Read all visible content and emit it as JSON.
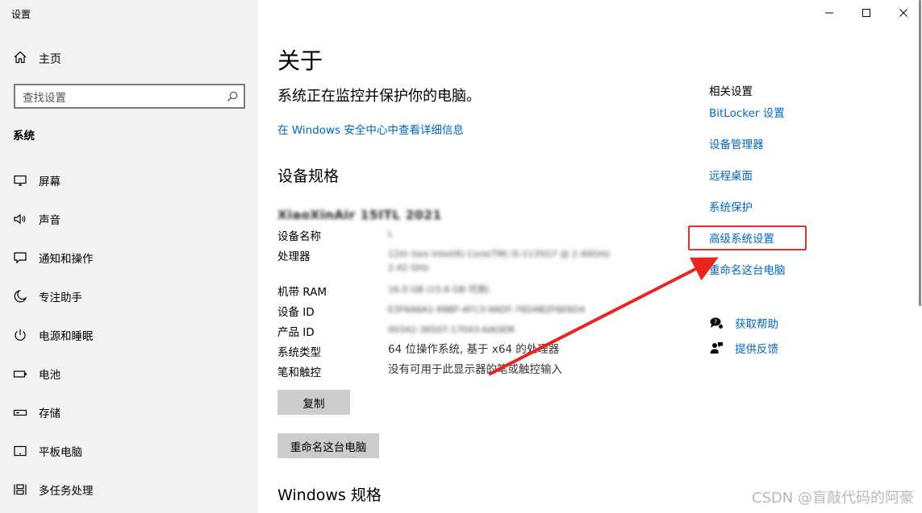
{
  "window": {
    "title": "设置",
    "controls": {
      "minimize": "minimize-icon",
      "maximize": "maximize-icon",
      "close": "close-icon"
    }
  },
  "sidebar": {
    "home_label": "主页",
    "search_placeholder": "查找设置",
    "section_label": "系统",
    "items": [
      {
        "label": "屏幕",
        "icon": "monitor-icon"
      },
      {
        "label": "声音",
        "icon": "speaker-icon"
      },
      {
        "label": "通知和操作",
        "icon": "notification-icon"
      },
      {
        "label": "专注助手",
        "icon": "moon-icon"
      },
      {
        "label": "电源和睡眠",
        "icon": "power-icon"
      },
      {
        "label": "电池",
        "icon": "battery-icon"
      },
      {
        "label": "存储",
        "icon": "storage-icon"
      },
      {
        "label": "平板电脑",
        "icon": "tablet-icon"
      },
      {
        "label": "多任务处理",
        "icon": "multitask-icon"
      }
    ]
  },
  "main": {
    "title": "关于",
    "protect_text": "系统正在监控并保护你的电脑。",
    "security_link": "在 Windows 安全中心中查看详细信息",
    "device_spec_heading": "设备规格",
    "device_model": "XiaoXinAir 15ITL 2021",
    "specs": [
      {
        "key": "设备名称",
        "value": "L"
      },
      {
        "key": "处理器",
        "value": "11th Gen Intel(R) Core(TM) i5-1135G7 @ 2.40GHz   2.42 GHz"
      },
      {
        "key": "机带 RAM",
        "value": "16.0 GB (15.6 GB 可用)"
      },
      {
        "key": "设备 ID",
        "value": "E3F6A6A1-99BF-4FC3-9ADF-76D4B2F6E6D4"
      },
      {
        "key": "产品 ID",
        "value": "00342-36507-17043-AAOEM"
      },
      {
        "key": "系统类型",
        "value": "64 位操作系统, 基于 x64 的处理器"
      },
      {
        "key": "笔和触控",
        "value": "没有可用于此显示器的笔或触控输入"
      }
    ],
    "copy_button": "复制",
    "rename_button": "重命名这台电脑",
    "windows_spec_heading": "Windows 规格"
  },
  "related": {
    "title": "相关设置",
    "links": [
      "BitLocker 设置",
      "设备管理器",
      "远程桌面",
      "系统保护",
      "高级系统设置",
      "重命名这台电脑"
    ],
    "highlighted_index": 4,
    "help": [
      {
        "label": "获取帮助",
        "icon": "help-chat-icon"
      },
      {
        "label": "提供反馈",
        "icon": "feedback-icon"
      }
    ]
  },
  "annotation": {
    "arrow_color": "#e8261f",
    "box_color": "#e53030"
  },
  "watermark": "CSDN @盲敲代码的阿豪",
  "colors": {
    "link": "#0067c0",
    "sidebar_bg": "#f2f2f2",
    "button_bg": "#cccccc"
  }
}
